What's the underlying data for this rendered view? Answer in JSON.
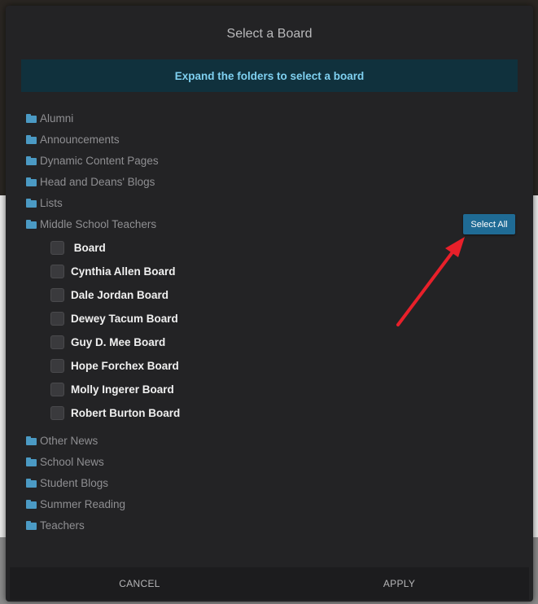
{
  "dialog": {
    "title": "Select a Board",
    "banner": "Expand the folders to select a board",
    "select_all_label": "Select All",
    "cancel_label": "CANCEL",
    "apply_label": "APPLY"
  },
  "folders_top": [
    {
      "label": "Alumni"
    },
    {
      "label": "Announcements"
    },
    {
      "label": "Dynamic Content Pages"
    },
    {
      "label": "Head and Deans' Blogs"
    },
    {
      "label": "Lists"
    },
    {
      "label": "Middle School Teachers"
    }
  ],
  "boards": [
    {
      "label": " Board",
      "checked": false
    },
    {
      "label": "Cynthia Allen Board",
      "checked": false
    },
    {
      "label": "Dale Jordan Board",
      "checked": false
    },
    {
      "label": "Dewey Tacum Board",
      "checked": false
    },
    {
      "label": "Guy D. Mee Board",
      "checked": false
    },
    {
      "label": "Hope Forchex Board",
      "checked": false
    },
    {
      "label": "Molly Ingerer Board",
      "checked": false
    },
    {
      "label": "Robert Burton Board",
      "checked": false
    }
  ],
  "folders_bottom": [
    {
      "label": "Other News"
    },
    {
      "label": "School News"
    },
    {
      "label": "Student Blogs"
    },
    {
      "label": "Summer Reading"
    },
    {
      "label": "Teachers"
    }
  ],
  "colors": {
    "accent": "#1f6b95",
    "folder_icon": "#4b9ac4",
    "banner_bg": "#10313d",
    "banner_text": "#7fd0f0",
    "annotation_arrow": "#e8202a"
  },
  "icons": {
    "folder": "folder-icon",
    "annotation": "red-arrow-icon"
  }
}
